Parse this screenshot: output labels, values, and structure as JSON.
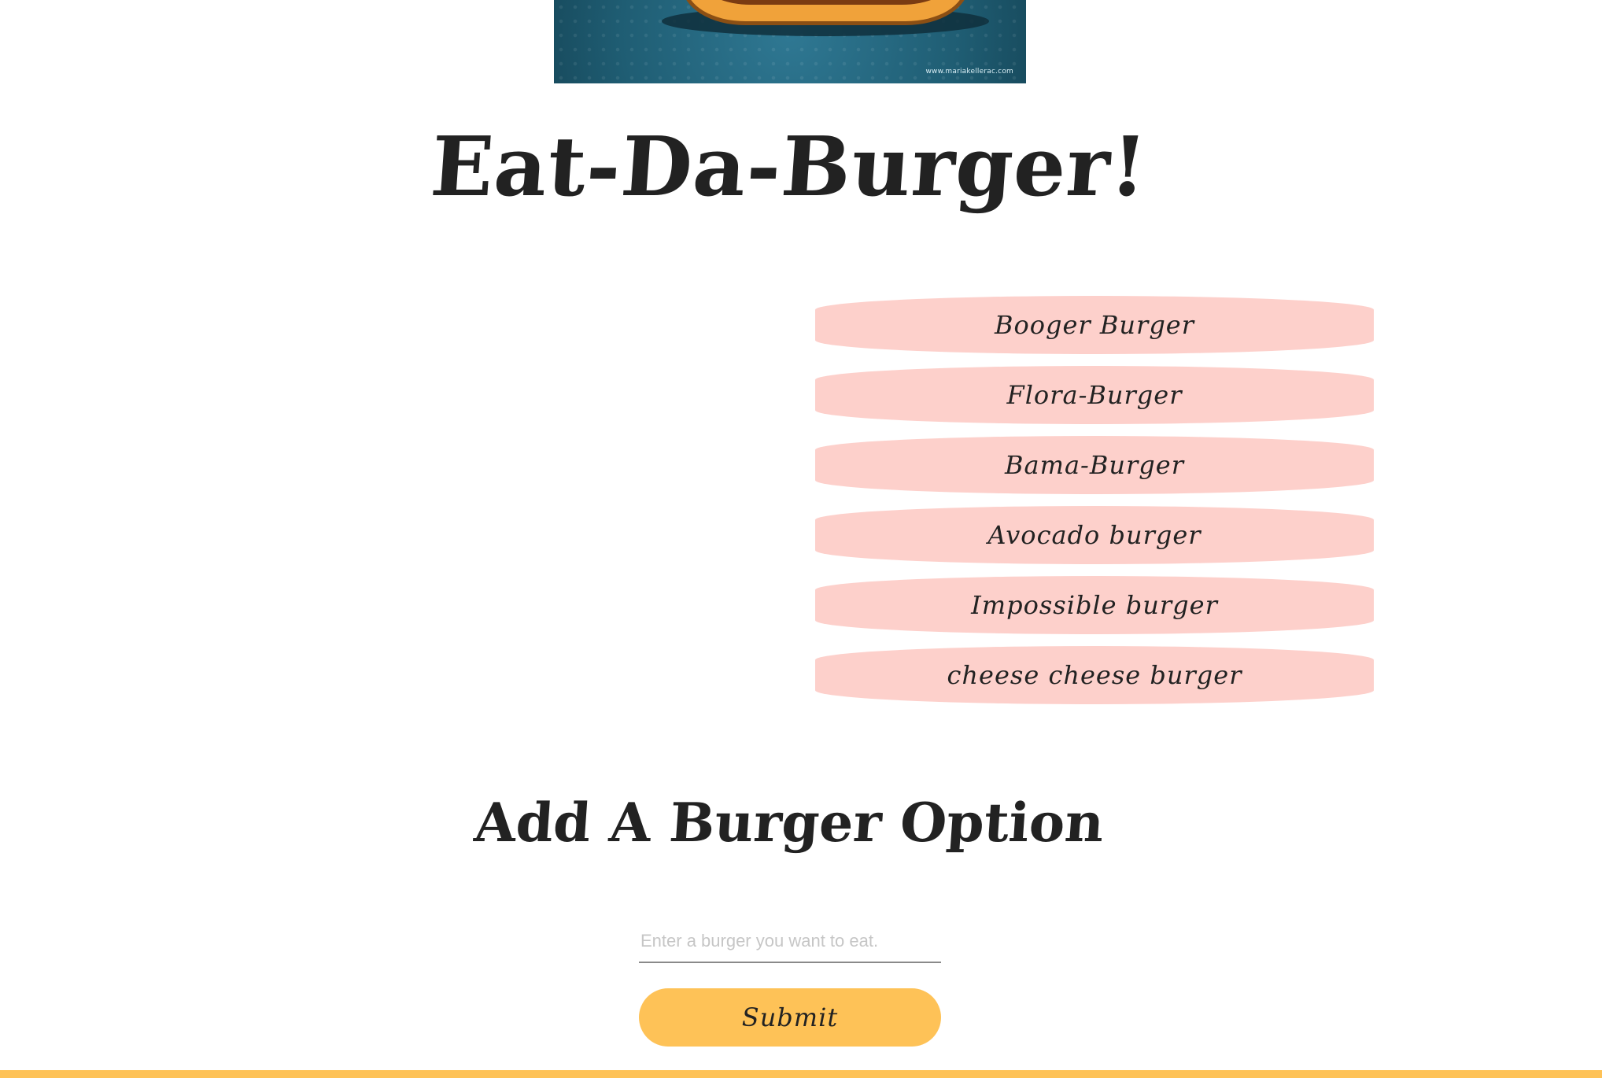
{
  "hero": {
    "image_credit": "www.mariakellerac.com"
  },
  "header": {
    "title": "Eat-Da-Burger!"
  },
  "burgers": [
    {
      "label": "Booger Burger"
    },
    {
      "label": "Flora-Burger"
    },
    {
      "label": "Bama-Burger"
    },
    {
      "label": "Avocado burger"
    },
    {
      "label": "Impossible burger"
    },
    {
      "label": "cheese cheese burger"
    }
  ],
  "add_form": {
    "title": "Add A Burger Option",
    "input_placeholder": "Enter a burger you want to eat.",
    "input_value": "",
    "submit_label": "Submit"
  },
  "colors": {
    "burger_item_bg": "#fdd0cb",
    "submit_bg": "#fec257",
    "footer_bar": "#fec257",
    "text": "#222222"
  }
}
